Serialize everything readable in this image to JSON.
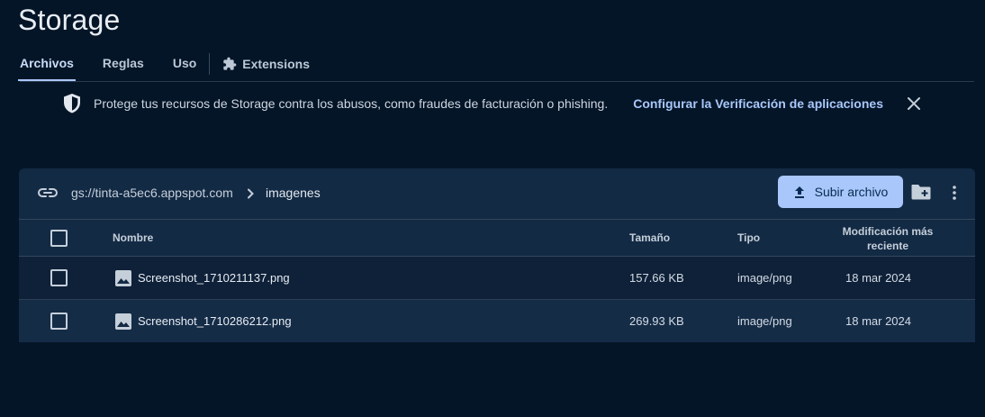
{
  "page": {
    "title": "Storage"
  },
  "tabs": [
    {
      "label": "Archivos",
      "active": true
    },
    {
      "label": "Reglas",
      "active": false
    },
    {
      "label": "Uso",
      "active": false
    },
    {
      "label": "Extensions",
      "active": false,
      "icon": "puzzle-icon"
    }
  ],
  "banner": {
    "icon": "shield-icon",
    "text": "Protege tus recursos de Storage contra los abusos, como fraudes de facturación o phishing.",
    "link": "Configurar la Verificación de aplicaciones",
    "close_icon": "close-icon"
  },
  "browser": {
    "bucket": "gs://tinta-a5ec6.appspot.com",
    "current_folder": "imagenes",
    "upload_label": "Subir archivo",
    "accent": "#a9c7fa"
  },
  "table": {
    "headers": {
      "name": "Nombre",
      "size": "Tamaño",
      "type": "Tipo",
      "modified_line1": "Modificación más",
      "modified_line2": "reciente"
    },
    "rows": [
      {
        "name": "Screenshot_1710211137.png",
        "size": "157.66 KB",
        "type": "image/png",
        "modified": "18 mar 2024"
      },
      {
        "name": "Screenshot_1710286212.png",
        "size": "269.93 KB",
        "type": "image/png",
        "modified": "18 mar 2024"
      }
    ]
  }
}
